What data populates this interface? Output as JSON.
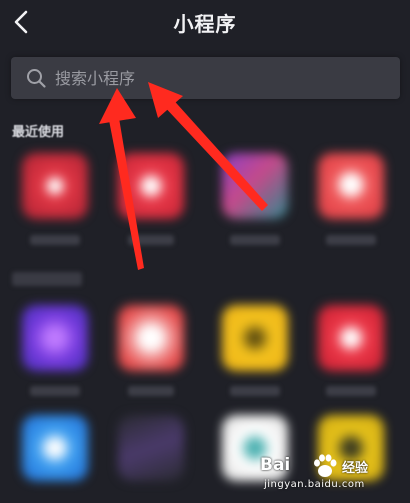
{
  "header": {
    "title": "小程序",
    "back_icon": "chevron-left-icon"
  },
  "search": {
    "placeholder": "搜索小程序",
    "icon": "search-icon"
  },
  "sections": {
    "recent": {
      "title": "最近使用"
    }
  },
  "watermark": {
    "brand": "Bai",
    "brand_suffix": "经验",
    "domain": "jingyan.baidu.com"
  },
  "colors": {
    "background": "#1f2027",
    "search_bg": "#3a3b43",
    "arrow": "#ff2a1f"
  }
}
